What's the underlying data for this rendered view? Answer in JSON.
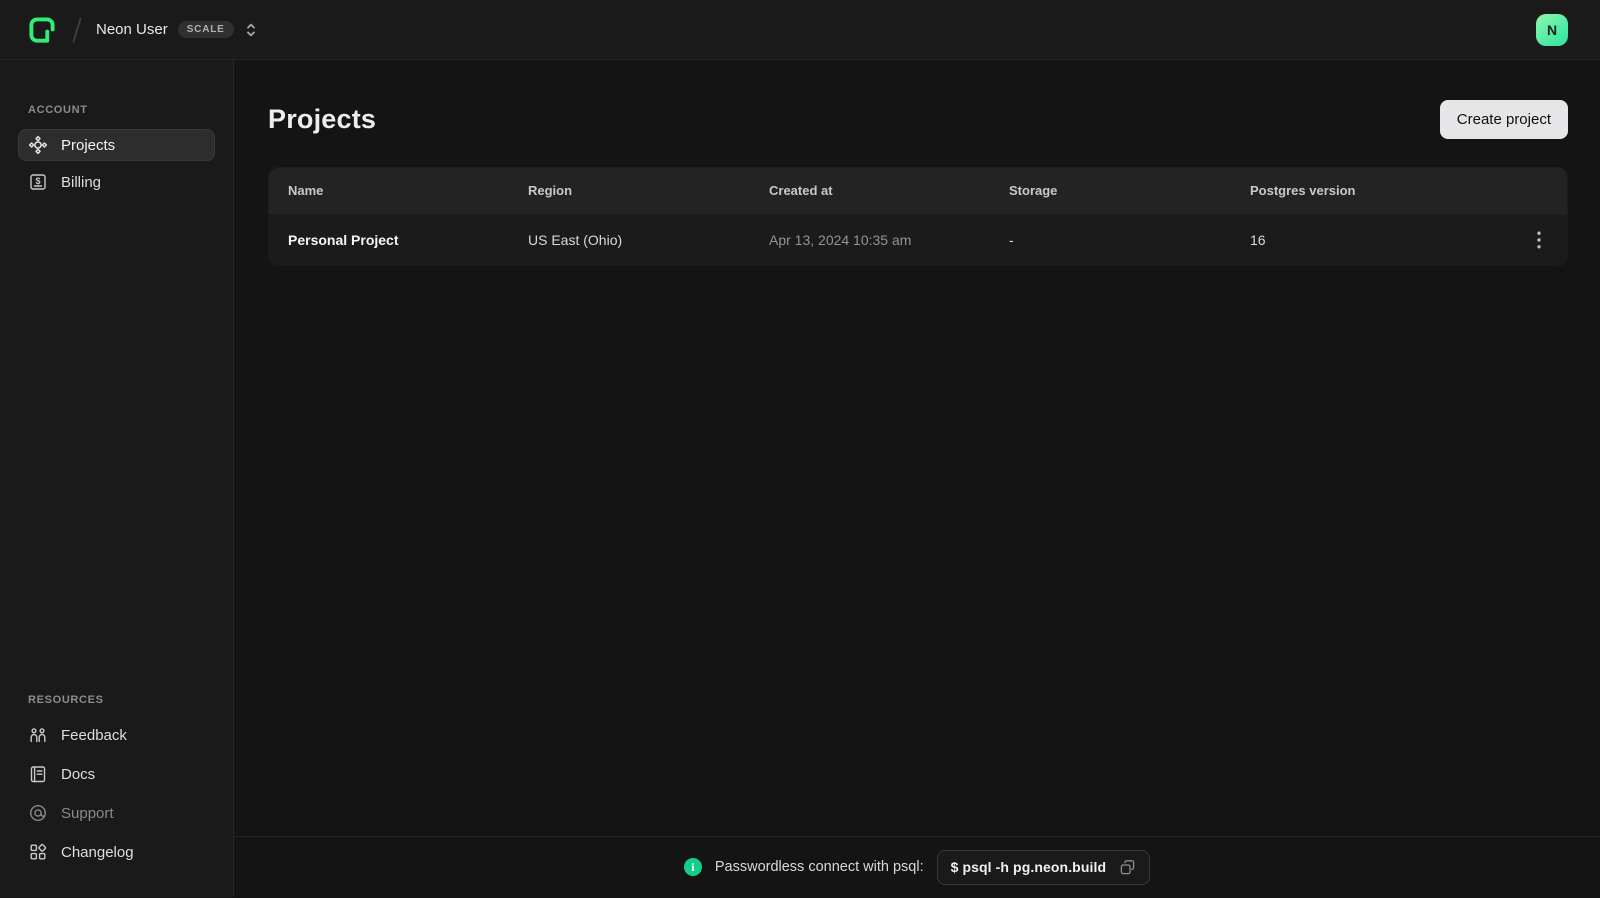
{
  "topbar": {
    "org_name": "Neon User",
    "plan_badge": "SCALE",
    "avatar_initial": "N"
  },
  "sidebar": {
    "account_section": "ACCOUNT",
    "account_items": [
      {
        "label": "Projects",
        "icon": "projects-node-icon",
        "active": true
      },
      {
        "label": "Billing",
        "icon": "dollar-square-icon",
        "active": false
      }
    ],
    "resources_section": "RESOURCES",
    "resource_items": [
      {
        "label": "Feedback",
        "icon": "people-icon",
        "muted": false
      },
      {
        "label": "Docs",
        "icon": "document-icon",
        "muted": false
      },
      {
        "label": "Support",
        "icon": "lifebuoy-icon",
        "muted": true
      },
      {
        "label": "Changelog",
        "icon": "squares-grid-icon",
        "muted": false
      }
    ]
  },
  "main": {
    "title": "Projects",
    "create_button_label": "Create project",
    "table": {
      "columns": [
        "Name",
        "Region",
        "Created at",
        "Storage",
        "Postgres version"
      ],
      "rows": [
        {
          "name": "Personal Project",
          "region": "US East (Ohio)",
          "created_at": "Apr 13, 2024 10:35 am",
          "storage": "-",
          "postgres_version": "16"
        }
      ]
    }
  },
  "footer": {
    "message": "Passwordless connect with psql:",
    "command": "$ psql -h pg.neon.build"
  },
  "icons": {
    "neon-logo-icon": "rounded-square N outline, green gradient",
    "breadcrumb-slash": "diagonal divider",
    "selector-chevrons-icon": "up/down chevrons",
    "projects-node-icon": "circle with four diamond nodes",
    "dollar-square-icon": "dollar sign in square",
    "people-icon": "two person figures",
    "document-icon": "notebook with lines",
    "lifebuoy-icon": "circle within circle",
    "squares-grid-icon": "three squares and one diamond",
    "kebab-icon": "three vertical dots",
    "info-icon": "green filled circle with i",
    "copy-icon": "two overlapping squares"
  },
  "colors": {
    "brand_green": "#00e599",
    "logo_gradient_start": "#62f655",
    "logo_gradient_end": "#00e599",
    "avatar_gradient_start": "#8df7ae",
    "avatar_gradient_end": "#2ce3a0",
    "info_icon_green": "#13cd8a",
    "page_background": "#141414",
    "panel_background": "#1a1a1a"
  }
}
